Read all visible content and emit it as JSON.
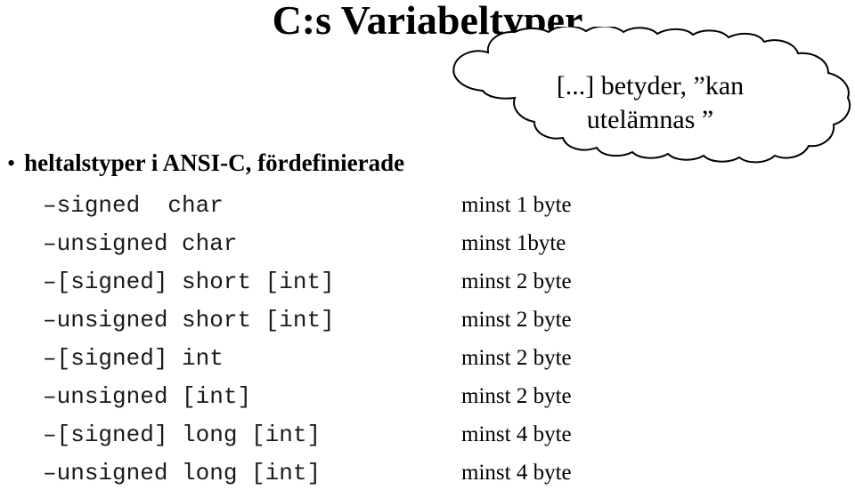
{
  "slide": {
    "title": "C:s Variabeltyper",
    "bullet": {
      "marker": "•",
      "text": "heltalstyper i ANSI-C, fördefinierade"
    },
    "callout": {
      "name": "cloud-callout",
      "line1": "[...] betyder, ”kan",
      "line2": "utelämnas ”"
    },
    "types": [
      {
        "marker": "–",
        "decl": "signed  char",
        "size": "minst 1 byte"
      },
      {
        "marker": "–",
        "decl": "unsigned char",
        "size": "minst 1byte"
      },
      {
        "marker": "–",
        "decl": "[signed] short [int]",
        "size": "minst 2 byte"
      },
      {
        "marker": "–",
        "decl": "unsigned short [int]",
        "size": "minst 2 byte"
      },
      {
        "marker": "–",
        "decl": "[signed] int",
        "size": "minst 2 byte"
      },
      {
        "marker": "–",
        "decl": "unsigned [int]",
        "size": "minst 2 byte"
      },
      {
        "marker": "–",
        "decl": "[signed] long [int]",
        "size": "minst 4 byte"
      },
      {
        "marker": "–",
        "decl": "unsigned long [int]",
        "size": "minst 4 byte"
      }
    ]
  },
  "colors": {
    "text": "#000000",
    "code": "#1a1a1a",
    "background": "#ffffff"
  }
}
